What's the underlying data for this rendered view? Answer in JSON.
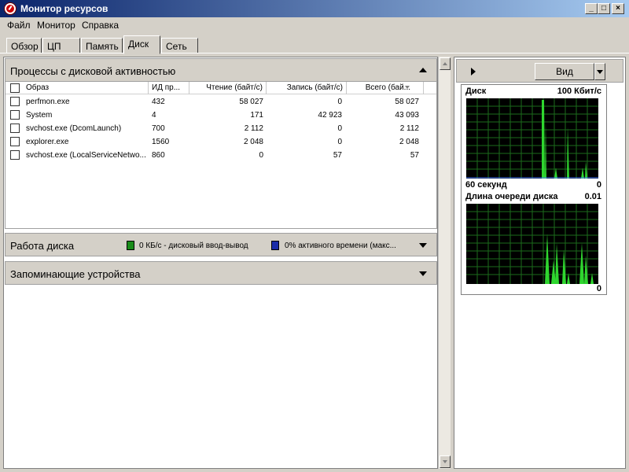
{
  "window": {
    "title": "Монитор ресурсов",
    "min": "_",
    "max": "□",
    "close": "×"
  },
  "menu": [
    "Файл",
    "Монитор",
    "Справка"
  ],
  "tabs": [
    "Обзор",
    "ЦП",
    "Память",
    "Диск",
    "Сеть"
  ],
  "active_tab": "Диск",
  "processes": {
    "title": "Процессы с дисковой активностью",
    "columns": [
      "Образ",
      "ИД пр...",
      "Чтение (байт/с)",
      "Запись (байт/с)",
      "Всего (бай..."
    ],
    "rows": [
      {
        "image": "perfmon.exe",
        "pid": "432",
        "read": "58 027",
        "write": "0",
        "total": "58 027"
      },
      {
        "image": "System",
        "pid": "4",
        "read": "171",
        "write": "42 923",
        "total": "43 093"
      },
      {
        "image": "svchost.exe (DcomLaunch)",
        "pid": "700",
        "read": "2 112",
        "write": "0",
        "total": "2 112"
      },
      {
        "image": "explorer.exe",
        "pid": "1560",
        "read": "2 048",
        "write": "0",
        "total": "2 048"
      },
      {
        "image": "svchost.exe (LocalServiceNetwo...",
        "pid": "860",
        "read": "0",
        "write": "57",
        "total": "57"
      }
    ]
  },
  "disk_activity": {
    "title": "Работа диска",
    "legend_io": "0 КБ/с - дисковый ввод-вывод",
    "legend_active": "0% активного времени (макс...",
    "color_io": "#1a8c1a",
    "color_active": "#1a2ca8"
  },
  "storage": {
    "title": "Запоминающие устройства"
  },
  "right_pane": {
    "view_label": "Вид",
    "graph1": {
      "title": "Диск",
      "max": "100 Кбит/с",
      "time": "60 секунд",
      "min": "0"
    },
    "graph2": {
      "title": "Длина очереди диска",
      "max": "0.01",
      "min": "0"
    }
  }
}
